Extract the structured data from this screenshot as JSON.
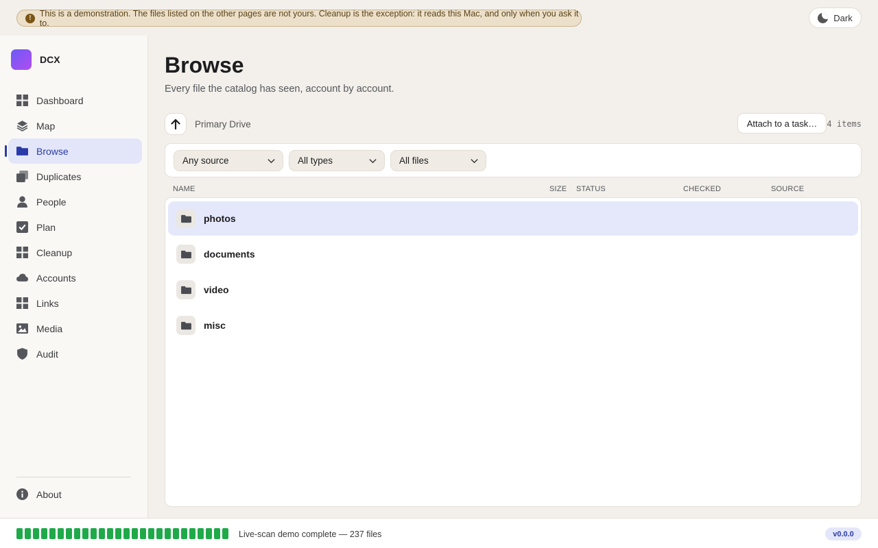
{
  "banner": {
    "text": "This is a demonstration. The files listed on the other pages are not yours. Cleanup is the exception: it reads this Mac, and only when you ask it to.",
    "icon": "exclamation-icon"
  },
  "theme_toggle": {
    "label": "Dark",
    "icon": "moon-icon"
  },
  "brand": {
    "name": "DCX"
  },
  "sidebar": {
    "items": [
      {
        "label": "Dashboard",
        "icon": "grid-icon",
        "active": false
      },
      {
        "label": "Map",
        "icon": "layers-icon",
        "active": false
      },
      {
        "label": "Browse",
        "icon": "folder-icon",
        "active": true
      },
      {
        "label": "Duplicates",
        "icon": "copy-icon",
        "active": false
      },
      {
        "label": "People",
        "icon": "person-icon",
        "active": false
      },
      {
        "label": "Plan",
        "icon": "checkbox-icon",
        "active": false
      },
      {
        "label": "Cleanup",
        "icon": "grid-icon",
        "active": false
      },
      {
        "label": "Accounts",
        "icon": "cloud-icon",
        "active": false
      },
      {
        "label": "Links",
        "icon": "grid-icon",
        "active": false
      },
      {
        "label": "Media",
        "icon": "image-icon",
        "active": false
      },
      {
        "label": "Audit",
        "icon": "shield-icon",
        "active": false
      }
    ],
    "about": {
      "label": "About",
      "icon": "info-icon"
    }
  },
  "page": {
    "title": "Browse",
    "subtitle": "Every file the catalog has seen, account by account."
  },
  "toolbar": {
    "breadcrumb": "Primary Drive",
    "attach_label": "Attach to a task…",
    "item_count": "4 items"
  },
  "filters": {
    "source": "Any source",
    "type": "All types",
    "files": "All files"
  },
  "columns": [
    "NAME",
    "SIZE",
    "STATUS",
    "CHECKED",
    "SOURCE"
  ],
  "rows": [
    {
      "name": "photos",
      "selected": true
    },
    {
      "name": "documents",
      "selected": false
    },
    {
      "name": "video",
      "selected": false
    },
    {
      "name": "misc",
      "selected": false
    }
  ],
  "footer": {
    "progress": 1.0,
    "scan_status": "Live-scan demo complete — 237 files",
    "version": "v0.0.0"
  },
  "colors": {
    "accent": "#2a3aa8",
    "progress": "#1faa4a",
    "background": "#f3f0eb",
    "banner": "#ece0cb"
  }
}
